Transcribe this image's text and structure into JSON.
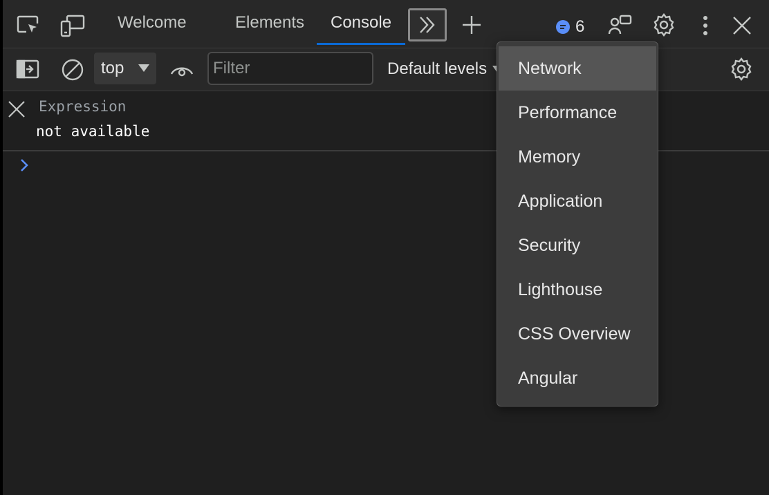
{
  "tabbar": {
    "tabs": [
      {
        "label": "Welcome",
        "active": false
      },
      {
        "label": "Elements",
        "active": false
      },
      {
        "label": "Console",
        "active": true
      }
    ],
    "issues_count": "6",
    "icons": [
      "inspect-element-icon",
      "device-toolbar-icon",
      "more-tabs-icon",
      "add-tab-icon",
      "issues-icon",
      "customize-icon",
      "settings-icon",
      "more-menu-icon",
      "close-icon"
    ]
  },
  "toolbar": {
    "context": "top",
    "filter_placeholder": "Filter",
    "filter_value": "",
    "levels_label": "Default levels",
    "icons": [
      "sidebar-toggle-icon",
      "clear-console-icon",
      "live-expression-eye-icon",
      "console-settings-icon"
    ]
  },
  "live_expression": {
    "label": "Expression",
    "value": "not available"
  },
  "more_tabs_menu": {
    "items": [
      {
        "label": "Network",
        "highlighted": true
      },
      {
        "label": "Performance",
        "highlighted": false
      },
      {
        "label": "Memory",
        "highlighted": false
      },
      {
        "label": "Application",
        "highlighted": false
      },
      {
        "label": "Security",
        "highlighted": false
      },
      {
        "label": "Lighthouse",
        "highlighted": false
      },
      {
        "label": "CSS Overview",
        "highlighted": false
      },
      {
        "label": "Angular",
        "highlighted": false
      }
    ]
  },
  "colors": {
    "accent": "#0a6ad6",
    "prompt": "#5b8ff9",
    "background": "#1f1f1f"
  }
}
